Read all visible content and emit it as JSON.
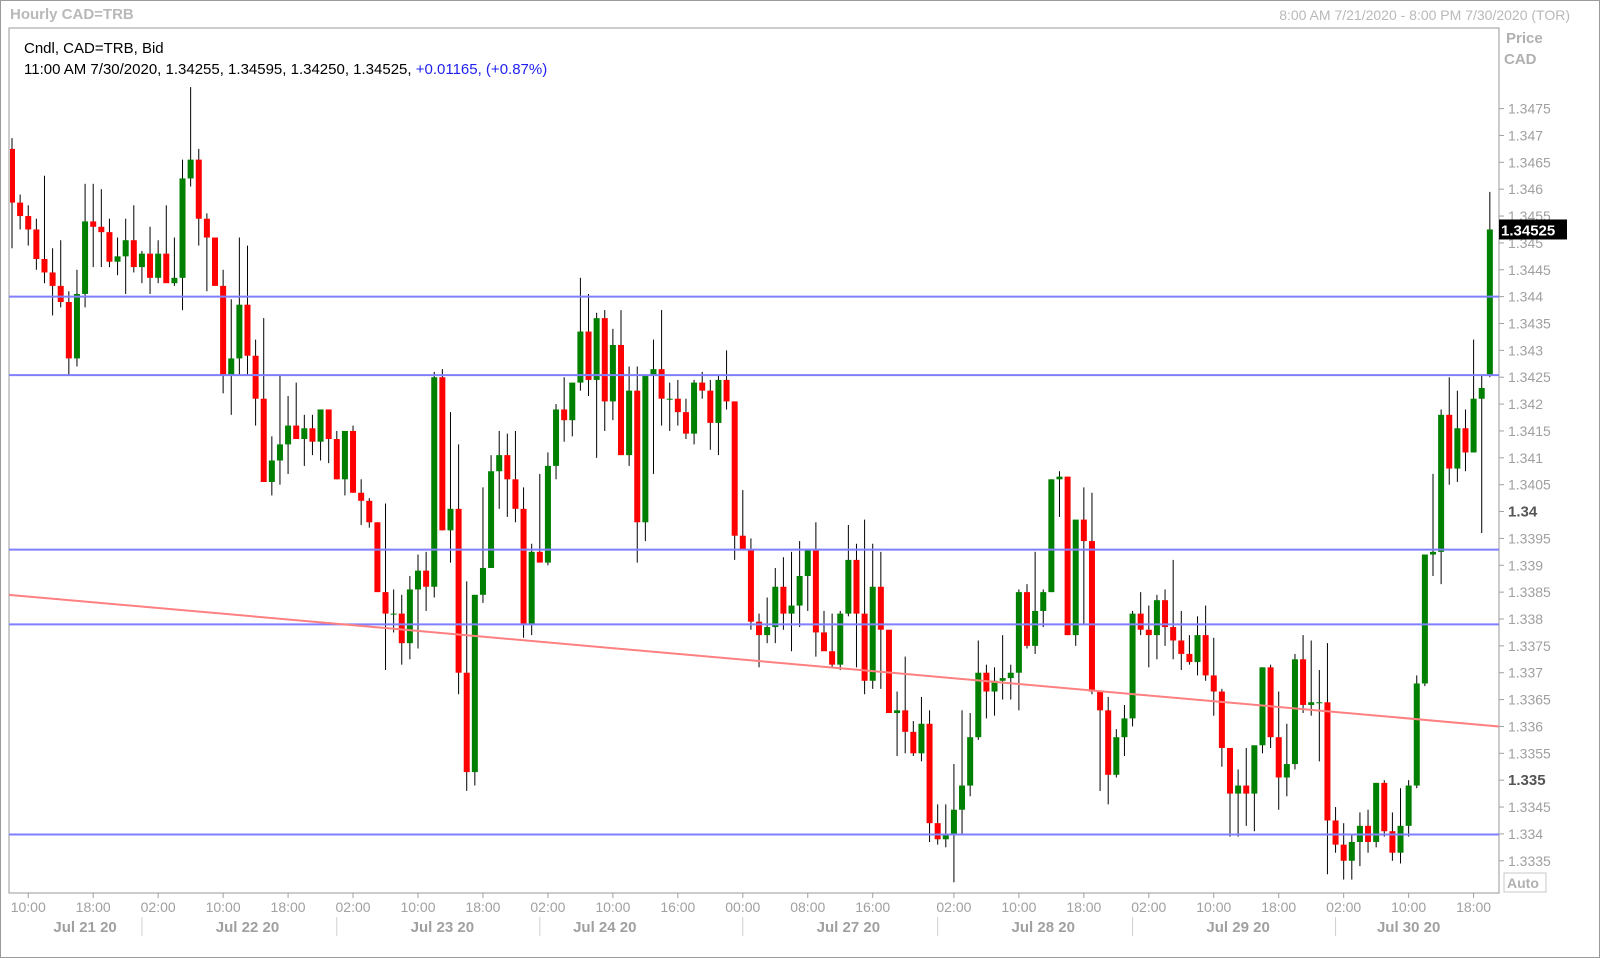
{
  "header": {
    "title": "Hourly CAD=TRB",
    "range": "8:00 AM 7/21/2020 - 8:00 PM 7/30/2020 (TOR)"
  },
  "info": {
    "line1": "Cndl, CAD=TRB, Bid",
    "line2_prefix": "11:00 AM 7/30/2020, 1.34255, 1.34595, 1.34250, 1.34525,",
    "line2_change": "+0.01165, (+0.87%)"
  },
  "price_axis": {
    "label1": "Price",
    "label2": "CAD",
    "auto": "Auto"
  },
  "colors": {
    "up": "#008000",
    "down": "#ff0000",
    "hline": "#7f7fff",
    "trend": "#ff8080",
    "grid_text": "#a0a0a0"
  },
  "chart_data": {
    "type": "candlestick",
    "last_price": 1.34525,
    "y_ticks": [
      "1.3475",
      "1.347",
      "1.3465",
      "1.346",
      "1.3455",
      "1.345",
      "1.3445",
      "1.344",
      "1.3435",
      "1.343",
      "1.3425",
      "1.342",
      "1.3415",
      "1.341",
      "1.3405",
      "1.34",
      "1.3395",
      "1.339",
      "1.3385",
      "1.338",
      "1.3375",
      "1.337",
      "1.3365",
      "1.336",
      "1.3355",
      "1.335",
      "1.3345",
      "1.334",
      "1.3335"
    ],
    "y_bold": [
      "1.34",
      "1.335"
    ],
    "ylim": [
      1.3329,
      1.349
    ],
    "x_ticks": [
      {
        "label": "10:00",
        "i": 2
      },
      {
        "label": "18:00",
        "i": 10
      },
      {
        "label": "02:00",
        "i": 18
      },
      {
        "label": "10:00",
        "i": 26
      },
      {
        "label": "18:00",
        "i": 34
      },
      {
        "label": "02:00",
        "i": 42
      },
      {
        "label": "10:00",
        "i": 50
      },
      {
        "label": "18:00",
        "i": 58
      },
      {
        "label": "02:00",
        "i": 66
      },
      {
        "label": "10:00",
        "i": 74
      },
      {
        "label": "16:00",
        "i": 82
      },
      {
        "label": "00:00",
        "i": 90
      },
      {
        "label": "08:00",
        "i": 98
      },
      {
        "label": "16:00",
        "i": 106
      },
      {
        "label": "02:00",
        "i": 116
      },
      {
        "label": "10:00",
        "i": 124
      },
      {
        "label": "18:00",
        "i": 132
      },
      {
        "label": "02:00",
        "i": 140
      },
      {
        "label": "10:00",
        "i": 148
      },
      {
        "label": "18:00",
        "i": 156
      },
      {
        "label": "02:00",
        "i": 164
      },
      {
        "label": "10:00",
        "i": 172
      },
      {
        "label": "18:00",
        "i": 180
      }
    ],
    "x_dates": [
      {
        "label": "Jul 21 20",
        "i": 9
      },
      {
        "label": "Jul 22 20",
        "i": 29
      },
      {
        "label": "Jul 23 20",
        "i": 53
      },
      {
        "label": "Jul 24 20",
        "i": 73
      },
      {
        "label": "Jul 27 20",
        "i": 103
      },
      {
        "label": "Jul 28 20",
        "i": 127
      },
      {
        "label": "Jul 29 20",
        "i": 151
      },
      {
        "label": "Jul 30 20",
        "i": 172
      }
    ],
    "date_separators": [
      16,
      40,
      65,
      90,
      114,
      138,
      163
    ],
    "horizontal_lines": [
      1.344,
      1.34254,
      1.33929,
      1.3379,
      1.33399
    ],
    "trendline": {
      "from": {
        "i": 0,
        "price": 1.33845
      },
      "to": {
        "i": 183,
        "price": 1.336
      }
    },
    "candles": [
      [
        1.34675,
        1.34695,
        1.3449,
        1.34575
      ],
      [
        1.34575,
        1.3459,
        1.34525,
        1.3455
      ],
      [
        1.3455,
        1.3457,
        1.34495,
        1.34525
      ],
      [
        1.34525,
        1.34545,
        1.3445,
        1.3447
      ],
      [
        1.3447,
        1.34625,
        1.34425,
        1.34445
      ],
      [
        1.34445,
        1.3449,
        1.34365,
        1.3442
      ],
      [
        1.3442,
        1.34505,
        1.3438,
        1.3439
      ],
      [
        1.3439,
        1.3441,
        1.34255,
        1.34285
      ],
      [
        1.34285,
        1.3445,
        1.3427,
        1.34405
      ],
      [
        1.34405,
        1.3461,
        1.3438,
        1.3454
      ],
      [
        1.3454,
        1.3461,
        1.34455,
        1.3453
      ],
      [
        1.3453,
        1.346,
        1.34455,
        1.3452
      ],
      [
        1.3452,
        1.34545,
        1.34455,
        1.34465
      ],
      [
        1.34465,
        1.3451,
        1.3444,
        1.34475
      ],
      [
        1.34475,
        1.34545,
        1.34405,
        1.34505
      ],
      [
        1.34505,
        1.3457,
        1.34445,
        1.34455
      ],
      [
        1.34455,
        1.34485,
        1.34425,
        1.3448
      ],
      [
        1.3448,
        1.3453,
        1.34405,
        1.34435
      ],
      [
        1.34435,
        1.34505,
        1.34425,
        1.3448
      ],
      [
        1.3448,
        1.3457,
        1.3443,
        1.34425
      ],
      [
        1.34425,
        1.3451,
        1.3442,
        1.34435
      ],
      [
        1.34435,
        1.34655,
        1.34375,
        1.3462
      ],
      [
        1.3462,
        1.3479,
        1.34605,
        1.34655
      ],
      [
        1.34655,
        1.34675,
        1.34495,
        1.34545
      ],
      [
        1.34545,
        1.34555,
        1.3441,
        1.3451
      ],
      [
        1.3451,
        1.3451,
        1.34435,
        1.3442
      ],
      [
        1.3442,
        1.3445,
        1.3422,
        1.34255
      ],
      [
        1.34255,
        1.34395,
        1.3418,
        1.34285
      ],
      [
        1.34285,
        1.3451,
        1.34255,
        1.34385
      ],
      [
        1.34385,
        1.34495,
        1.34255,
        1.3429
      ],
      [
        1.3429,
        1.3432,
        1.3416,
        1.3421
      ],
      [
        1.3421,
        1.3436,
        1.3407,
        1.34055
      ],
      [
        1.34055,
        1.3414,
        1.3403,
        1.34095
      ],
      [
        1.34095,
        1.34255,
        1.3405,
        1.34125
      ],
      [
        1.34125,
        1.34215,
        1.3407,
        1.3416
      ],
      [
        1.3416,
        1.3424,
        1.34135,
        1.34135
      ],
      [
        1.34135,
        1.3418,
        1.34085,
        1.34155
      ],
      [
        1.34155,
        1.3418,
        1.34105,
        1.3413
      ],
      [
        1.3413,
        1.3419,
        1.34095,
        1.3419
      ],
      [
        1.3419,
        1.3419,
        1.3409,
        1.34135
      ],
      [
        1.34135,
        1.3415,
        1.3406,
        1.3406
      ],
      [
        1.3406,
        1.3414,
        1.3403,
        1.3415
      ],
      [
        1.3415,
        1.3416,
        1.34035,
        1.34035
      ],
      [
        1.34035,
        1.3406,
        1.33975,
        1.3402
      ],
      [
        1.3402,
        1.34025,
        1.3397,
        1.3398
      ],
      [
        1.3398,
        1.3398,
        1.33855,
        1.3385
      ],
      [
        1.3385,
        1.34015,
        1.33705,
        1.3381
      ],
      [
        1.3381,
        1.33855,
        1.33775,
        1.3381
      ],
      [
        1.3381,
        1.33845,
        1.33715,
        1.33755
      ],
      [
        1.33755,
        1.3388,
        1.33725,
        1.33855
      ],
      [
        1.33855,
        1.3392,
        1.33745,
        1.3389
      ],
      [
        1.3389,
        1.33925,
        1.33815,
        1.3386
      ],
      [
        1.3386,
        1.3426,
        1.3384,
        1.3425
      ],
      [
        1.3425,
        1.34265,
        1.33965,
        1.33965
      ],
      [
        1.33965,
        1.34185,
        1.33905,
        1.34005
      ],
      [
        1.34005,
        1.34125,
        1.3366,
        1.337
      ],
      [
        1.337,
        1.3387,
        1.3348,
        1.33515
      ],
      [
        1.33515,
        1.33845,
        1.3349,
        1.33845
      ],
      [
        1.33845,
        1.34045,
        1.3383,
        1.33895
      ],
      [
        1.33895,
        1.34105,
        1.33895,
        1.34075
      ],
      [
        1.34075,
        1.3415,
        1.34005,
        1.34105
      ],
      [
        1.34105,
        1.34145,
        1.3399,
        1.3406
      ],
      [
        1.3406,
        1.3415,
        1.3398,
        1.34005
      ],
      [
        1.34005,
        1.34045,
        1.33765,
        1.3379
      ],
      [
        1.3379,
        1.3394,
        1.3377,
        1.33925
      ],
      [
        1.33925,
        1.3407,
        1.33905,
        1.33905
      ],
      [
        1.33905,
        1.3411,
        1.339,
        1.34085
      ],
      [
        1.34085,
        1.342,
        1.3406,
        1.3419
      ],
      [
        1.3419,
        1.3425,
        1.3413,
        1.3417
      ],
      [
        1.3417,
        1.3421,
        1.3414,
        1.3424
      ],
      [
        1.3424,
        1.34435,
        1.34225,
        1.34335
      ],
      [
        1.34335,
        1.34405,
        1.34215,
        1.34245
      ],
      [
        1.34245,
        1.3437,
        1.341,
        1.3436
      ],
      [
        1.3436,
        1.34375,
        1.3415,
        1.34205
      ],
      [
        1.34205,
        1.3434,
        1.3417,
        1.3431
      ],
      [
        1.3431,
        1.34375,
        1.34105,
        1.34105
      ],
      [
        1.34105,
        1.3427,
        1.34085,
        1.34225
      ],
      [
        1.34225,
        1.3427,
        1.33905,
        1.3398
      ],
      [
        1.3398,
        1.34255,
        1.33945,
        1.34255
      ],
      [
        1.34255,
        1.3432,
        1.3407,
        1.34265
      ],
      [
        1.34265,
        1.34375,
        1.3416,
        1.3421
      ],
      [
        1.3421,
        1.3424,
        1.3415,
        1.3421
      ],
      [
        1.3421,
        1.34245,
        1.3416,
        1.34185
      ],
      [
        1.34185,
        1.3421,
        1.34135,
        1.34145
      ],
      [
        1.34145,
        1.34245,
        1.34125,
        1.3424
      ],
      [
        1.3424,
        1.3426,
        1.3421,
        1.34225
      ],
      [
        1.34225,
        1.34245,
        1.34115,
        1.34165
      ],
      [
        1.34165,
        1.34255,
        1.34105,
        1.34245
      ],
      [
        1.34245,
        1.343,
        1.3419,
        1.34205
      ],
      [
        1.34205,
        1.34205,
        1.3391,
        1.33955
      ],
      [
        1.33955,
        1.3404,
        1.3393,
        1.3393
      ],
      [
        1.3393,
        1.3395,
        1.3378,
        1.33795
      ],
      [
        1.33795,
        1.3381,
        1.3371,
        1.3377
      ],
      [
        1.3377,
        1.3384,
        1.33755,
        1.33785
      ],
      [
        1.33785,
        1.33895,
        1.33755,
        1.3386
      ],
      [
        1.3386,
        1.33915,
        1.3378,
        1.3381
      ],
      [
        1.3381,
        1.33925,
        1.3374,
        1.33825
      ],
      [
        1.33825,
        1.33945,
        1.33785,
        1.3388
      ],
      [
        1.3388,
        1.3393,
        1.33815,
        1.3393
      ],
      [
        1.3393,
        1.3398,
        1.3373,
        1.33775
      ],
      [
        1.33775,
        1.33815,
        1.33745,
        1.3374
      ],
      [
        1.3374,
        1.3381,
        1.3371,
        1.33715
      ],
      [
        1.33715,
        1.33815,
        1.33705,
        1.3381
      ],
      [
        1.3381,
        1.33975,
        1.33805,
        1.3391
      ],
      [
        1.3391,
        1.3394,
        1.3371,
        1.3381
      ],
      [
        1.3381,
        1.33985,
        1.3366,
        1.33685
      ],
      [
        1.33685,
        1.3394,
        1.3367,
        1.3386
      ],
      [
        1.3386,
        1.33925,
        1.3367,
        1.3378
      ],
      [
        1.3378,
        1.3378,
        1.33625,
        1.33625
      ],
      [
        1.33625,
        1.33665,
        1.33545,
        1.3363
      ],
      [
        1.3363,
        1.3373,
        1.3355,
        1.3359
      ],
      [
        1.3359,
        1.3361,
        1.33545,
        1.3355
      ],
      [
        1.3355,
        1.33655,
        1.33535,
        1.33605
      ],
      [
        1.33605,
        1.3363,
        1.33385,
        1.3342
      ],
      [
        1.3342,
        1.33455,
        1.3338,
        1.3339
      ],
      [
        1.3339,
        1.33455,
        1.33375,
        1.334
      ],
      [
        1.334,
        1.3353,
        1.3331,
        1.33445
      ],
      [
        1.33445,
        1.3363,
        1.334,
        1.3349
      ],
      [
        1.3349,
        1.33625,
        1.3347,
        1.3358
      ],
      [
        1.3358,
        1.3376,
        1.33575,
        1.337
      ],
      [
        1.337,
        1.33715,
        1.33615,
        1.33665
      ],
      [
        1.33665,
        1.3371,
        1.3362,
        1.33685
      ],
      [
        1.33685,
        1.3377,
        1.3365,
        1.3369
      ],
      [
        1.3369,
        1.33715,
        1.3365,
        1.337
      ],
      [
        1.337,
        1.33855,
        1.3363,
        1.3385
      ],
      [
        1.3385,
        1.33865,
        1.33745,
        1.3375
      ],
      [
        1.3375,
        1.33925,
        1.33735,
        1.33815
      ],
      [
        1.33815,
        1.33855,
        1.33785,
        1.3385
      ],
      [
        1.3385,
        1.3406,
        1.3385,
        1.3406
      ],
      [
        1.3406,
        1.34075,
        1.3399,
        1.34065
      ],
      [
        1.34065,
        1.3405,
        1.3377,
        1.3377
      ],
      [
        1.3377,
        1.3393,
        1.3375,
        1.33985
      ],
      [
        1.33985,
        1.34045,
        1.3379,
        1.33945
      ],
      [
        1.33945,
        1.34035,
        1.3366,
        1.33665
      ],
      [
        1.33665,
        1.33665,
        1.3348,
        1.3363
      ],
      [
        1.3363,
        1.33655,
        1.33455,
        1.3351
      ],
      [
        1.3351,
        1.33595,
        1.33505,
        1.3358
      ],
      [
        1.3358,
        1.3364,
        1.33545,
        1.33615
      ],
      [
        1.33615,
        1.33815,
        1.336,
        1.3381
      ],
      [
        1.3381,
        1.3385,
        1.3377,
        1.3378
      ],
      [
        1.3378,
        1.33825,
        1.3371,
        1.3377
      ],
      [
        1.3377,
        1.33845,
        1.33725,
        1.33835
      ],
      [
        1.33835,
        1.33855,
        1.3375,
        1.33785
      ],
      [
        1.33785,
        1.3391,
        1.33725,
        1.3376
      ],
      [
        1.3376,
        1.33815,
        1.33705,
        1.33735
      ],
      [
        1.33735,
        1.3377,
        1.33715,
        1.3372
      ],
      [
        1.3372,
        1.33805,
        1.33695,
        1.3377
      ],
      [
        1.3377,
        1.33825,
        1.33685,
        1.33695
      ],
      [
        1.33695,
        1.33765,
        1.3362,
        1.33665
      ],
      [
        1.33665,
        1.3367,
        1.33525,
        1.3356
      ],
      [
        1.3356,
        1.3356,
        1.33395,
        1.33475
      ],
      [
        1.33475,
        1.3352,
        1.33395,
        1.3349
      ],
      [
        1.3349,
        1.3356,
        1.33415,
        1.33475
      ],
      [
        1.33475,
        1.3356,
        1.33405,
        1.33565
      ],
      [
        1.33565,
        1.3371,
        1.3355,
        1.3371
      ],
      [
        1.3371,
        1.33715,
        1.3356,
        1.3358
      ],
      [
        1.3358,
        1.33665,
        1.33445,
        1.33505
      ],
      [
        1.33505,
        1.33605,
        1.3347,
        1.3353
      ],
      [
        1.3353,
        1.33735,
        1.3352,
        1.33725
      ],
      [
        1.33725,
        1.3377,
        1.33625,
        1.3364
      ],
      [
        1.3364,
        1.3376,
        1.3362,
        1.33645
      ],
      [
        1.33645,
        1.33705,
        1.33535,
        1.33645
      ],
      [
        1.33645,
        1.33755,
        1.33325,
        1.33425
      ],
      [
        1.33425,
        1.3345,
        1.33365,
        1.3338
      ],
      [
        1.3338,
        1.3342,
        1.33315,
        1.3335
      ],
      [
        1.3335,
        1.334,
        1.33315,
        1.33385
      ],
      [
        1.33385,
        1.3344,
        1.3334,
        1.33415
      ],
      [
        1.33415,
        1.33445,
        1.33365,
        1.33385
      ],
      [
        1.33385,
        1.33495,
        1.33375,
        1.33495
      ],
      [
        1.33495,
        1.335,
        1.33395,
        1.33405
      ],
      [
        1.33405,
        1.3344,
        1.3335,
        1.33365
      ],
      [
        1.33365,
        1.33485,
        1.33345,
        1.33415
      ],
      [
        1.33415,
        1.335,
        1.33395,
        1.3349
      ],
      [
        1.3349,
        1.33695,
        1.33485,
        1.3368
      ],
      [
        1.3368,
        1.3392,
        1.33675,
        1.3392
      ],
      [
        1.3392,
        1.3407,
        1.3388,
        1.33925
      ],
      [
        1.33925,
        1.3419,
        1.33865,
        1.3418
      ],
      [
        1.3418,
        1.3425,
        1.3405,
        1.3408
      ],
      [
        1.3408,
        1.34225,
        1.34055,
        1.34155
      ],
      [
        1.34155,
        1.3419,
        1.34075,
        1.3411
      ],
      [
        1.3411,
        1.3432,
        1.3411,
        1.3421
      ],
      [
        1.3421,
        1.34255,
        1.3396,
        1.3423
      ],
      [
        1.34255,
        1.34595,
        1.3425,
        1.34525
      ]
    ]
  }
}
